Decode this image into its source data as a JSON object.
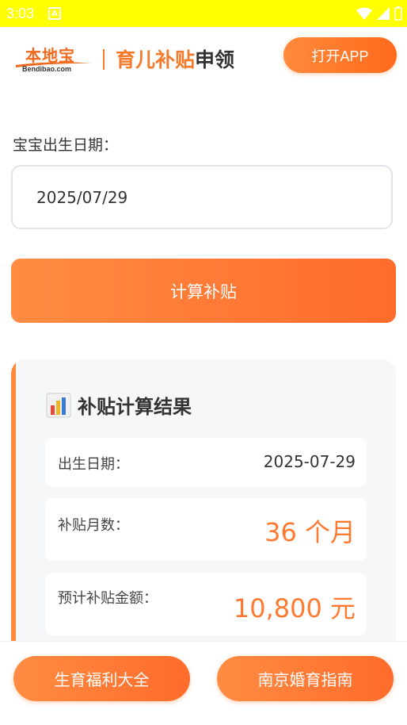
{
  "status_bar": {
    "time": "3:03",
    "notification_icon": "a-icon",
    "icons": [
      "wifi-icon",
      "signal-icon",
      "battery-icon"
    ]
  },
  "header": {
    "logo_text": "本地宝",
    "logo_sub": "Bendibao.com",
    "title_part1": "育儿补贴",
    "title_part2": "申领",
    "open_app_label": "打开APP"
  },
  "form": {
    "birth_label": "宝宝出生日期：",
    "birth_value": "2025/07/29",
    "calculate_label": "计算补贴"
  },
  "result": {
    "title": "补贴计算结果",
    "title_icon": "bar-chart-icon",
    "rows": [
      {
        "label": "出生日期：",
        "value": "2025-07-29"
      },
      {
        "label": "补贴月数：",
        "value": "36 个月"
      },
      {
        "label": "预计补贴金额：",
        "value": "10,800 元"
      }
    ]
  },
  "bottom": {
    "left_label": "生育福利大全",
    "right_label": "南京婚育指南"
  },
  "colors": {
    "accent": "#ff7a30",
    "status_bar": "#ffff00",
    "card_bg": "#f6f7f9"
  }
}
